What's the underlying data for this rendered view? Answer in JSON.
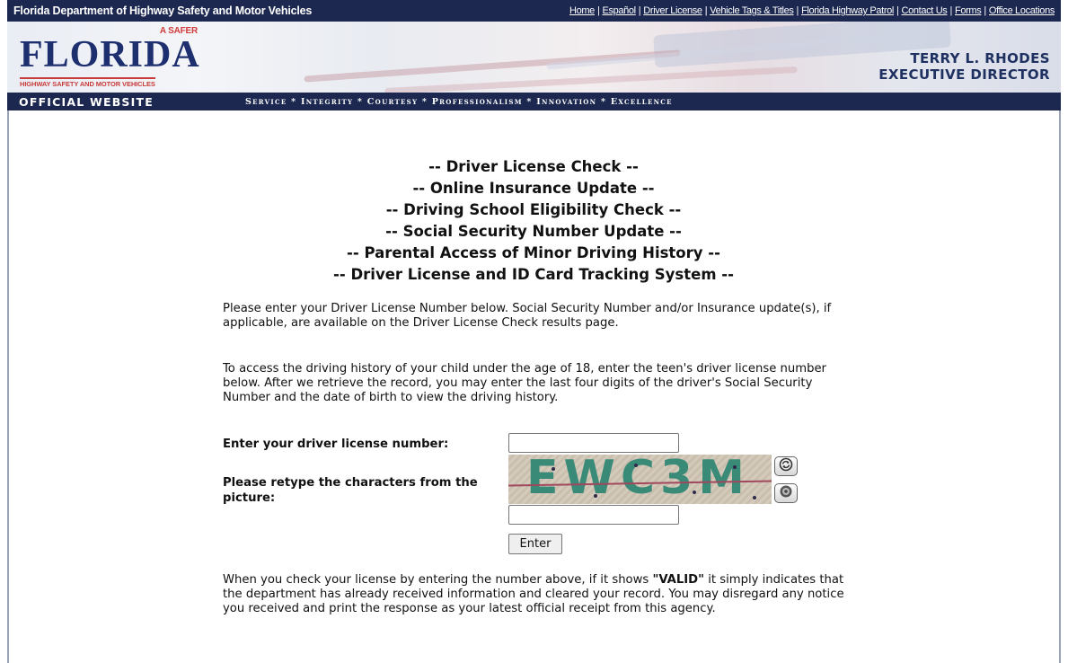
{
  "header": {
    "agency_name": "Florida Department of Highway Safety and Motor Vehicles",
    "nav_links": [
      "Home",
      "Español",
      "Driver License",
      "Vehicle Tags & Titles",
      "Florida Highway Patrol",
      "Contact Us",
      "Forms",
      "Office Locations"
    ]
  },
  "banner": {
    "logo_tagline": "A SAFER",
    "logo_word": "FLORIDA",
    "logo_subtitle": "HIGHWAY SAFETY AND MOTOR VEHICLES",
    "director_name": "TERRY L. RHODES",
    "director_title": "EXECUTIVE DIRECTOR"
  },
  "values_bar": {
    "official_label": "OFFICIAL WEBSITE",
    "values": "Service * Integrity * Courtesy * Professionalism * Innovation * Excellence"
  },
  "titles": [
    "-- Driver License Check --",
    "-- Online Insurance Update --",
    "-- Driving School Eligibility Check --",
    "-- Social Security Number Update --",
    "-- Parental Access of Minor Driving History --",
    "-- Driver License and ID Card Tracking System --"
  ],
  "instructions": {
    "para1": "Please enter your Driver License Number below. Social Security Number and/or Insurance update(s), if applicable, are available on the Driver License Check results page.",
    "para2": "To access the driving history of your child under the age of 18, enter the teen's driver license number below. After we retrieve the record, you may enter the last four digits of the driver's Social Security Number and the date of birth to view the driving history."
  },
  "form": {
    "dl_label": "Enter your driver license number:",
    "dl_value": "",
    "captcha_label": "Please retype the characters from the picture:",
    "captcha_text": "EWC3M",
    "captcha_value": "",
    "submit_label": "Enter"
  },
  "notice": {
    "before": "When you check your license by entering the number above, if it shows ",
    "emphasis": "\"VALID\"",
    "after": " it simply indicates that the department has already received information and cleared your record. You may disregard any notice you received and print the response as your latest official receipt from this agency."
  },
  "icons": {
    "refresh": "refresh-icon",
    "audio": "audio-icon"
  },
  "colors": {
    "nav_bg": "#1c2850",
    "logo_blue": "#1d2f6e",
    "logo_red": "#c93a3a"
  }
}
